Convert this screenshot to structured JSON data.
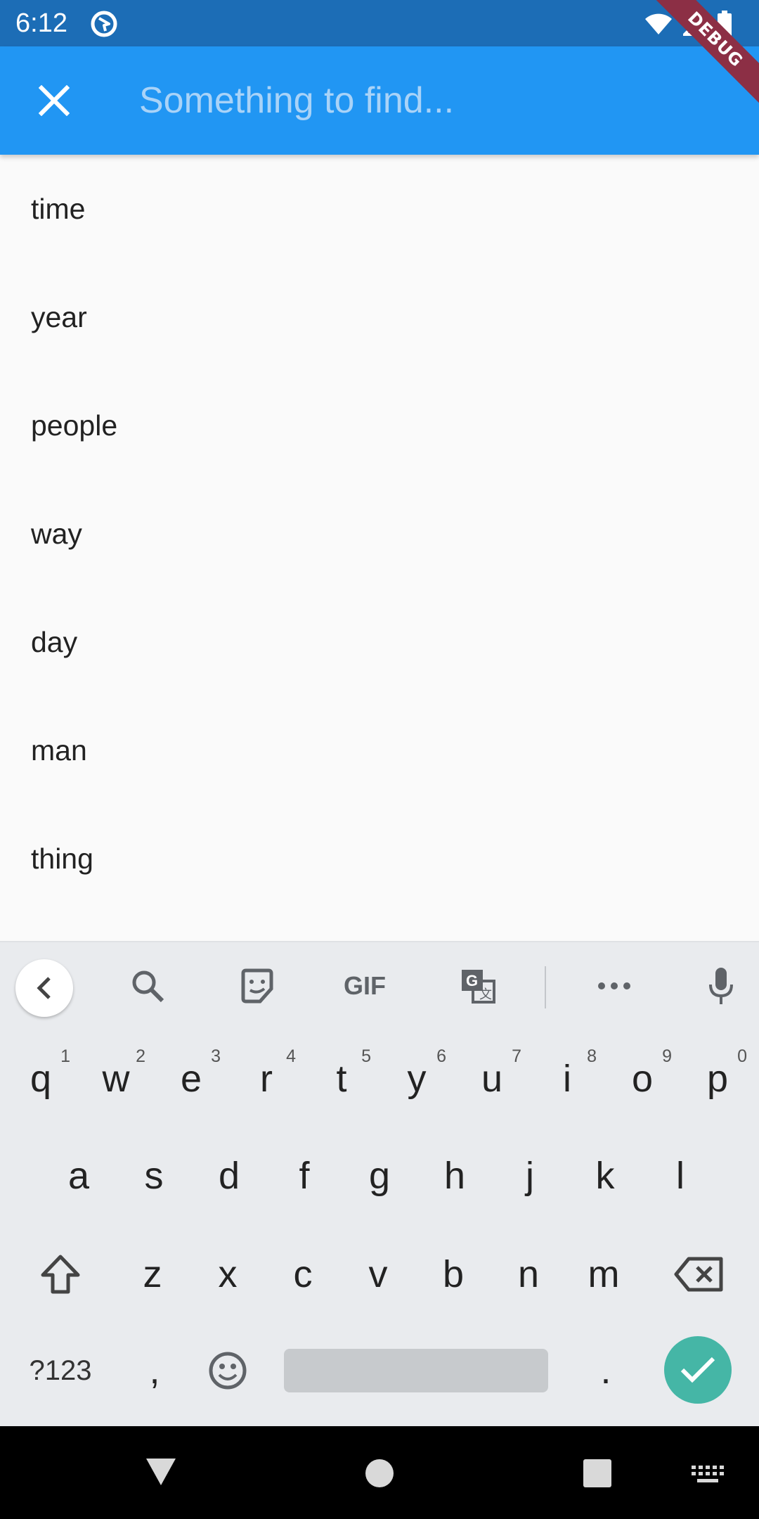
{
  "status_bar": {
    "time": "6:12",
    "icons": [
      "app-notification-icon",
      "wifi-icon",
      "signal-icon",
      "battery-icon"
    ]
  },
  "debug_banner": "DEBUG",
  "search": {
    "placeholder": "Something to find...",
    "value": ""
  },
  "results": [
    "time",
    "year",
    "people",
    "way",
    "day",
    "man",
    "thing"
  ],
  "keyboard": {
    "toolbar": [
      "back-arrow-icon",
      "search-icon",
      "sticker-icon",
      "GIF",
      "translate-icon",
      "more-icon",
      "microphone-icon"
    ],
    "gif_label": "GIF",
    "row1": [
      {
        "key": "q",
        "hint": "1"
      },
      {
        "key": "w",
        "hint": "2"
      },
      {
        "key": "e",
        "hint": "3"
      },
      {
        "key": "r",
        "hint": "4"
      },
      {
        "key": "t",
        "hint": "5"
      },
      {
        "key": "y",
        "hint": "6"
      },
      {
        "key": "u",
        "hint": "7"
      },
      {
        "key": "i",
        "hint": "8"
      },
      {
        "key": "o",
        "hint": "9"
      },
      {
        "key": "p",
        "hint": "0"
      }
    ],
    "row2": [
      "a",
      "s",
      "d",
      "f",
      "g",
      "h",
      "j",
      "k",
      "l"
    ],
    "row3": [
      "z",
      "x",
      "c",
      "v",
      "b",
      "n",
      "m"
    ],
    "symbols_label": "?123",
    "comma_label": ",",
    "period_label": "."
  },
  "colors": {
    "app_bar": "#2196f3",
    "status_bar": "#1c6db6",
    "debug_ribbon": "#8c2f45",
    "enter_key": "#45b6a6"
  }
}
